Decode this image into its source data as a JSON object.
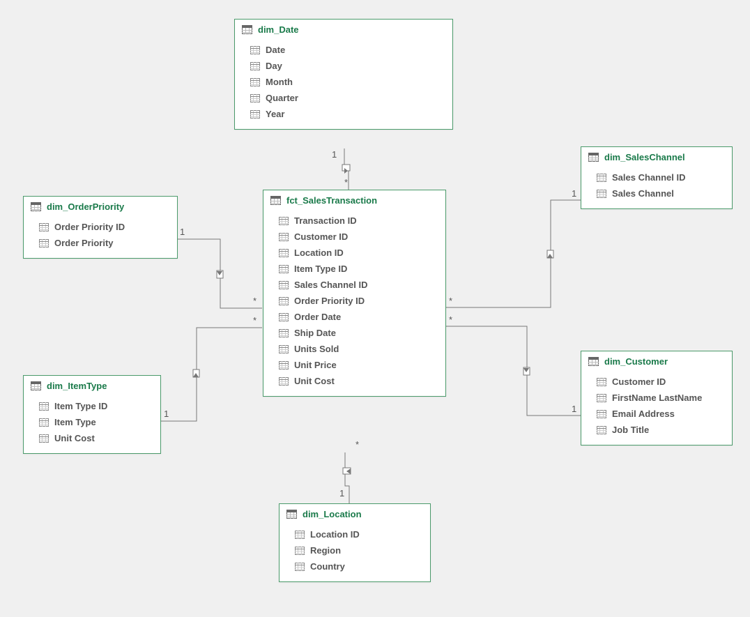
{
  "tables": {
    "date": {
      "title": "dim_Date",
      "fields": [
        "Date",
        "Day",
        "Month",
        "Quarter",
        "Year"
      ]
    },
    "salesChan": {
      "title": "dim_SalesChannel",
      "fields": [
        "Sales Channel ID",
        "Sales Channel"
      ]
    },
    "orderPrio": {
      "title": "dim_OrderPriority",
      "fields": [
        "Order Priority ID",
        "Order Priority"
      ]
    },
    "fact": {
      "title": "fct_SalesTransaction",
      "fields": [
        "Transaction ID",
        "Customer ID",
        "Location ID",
        "Item Type ID",
        "Sales Channel ID",
        "Order Priority ID",
        "Order Date",
        "Ship Date",
        "Units Sold",
        "Unit Price",
        "Unit Cost"
      ]
    },
    "itemType": {
      "title": "dim_ItemType",
      "fields": [
        "Item Type ID",
        "Item Type",
        "Unit Cost"
      ]
    },
    "customer": {
      "title": "dim_Customer",
      "fields": [
        "Customer ID",
        "FirstName LastName",
        "Email Address",
        "Job Title"
      ]
    },
    "location": {
      "title": "dim_Location",
      "fields": [
        "Location ID",
        "Region",
        "Country"
      ]
    }
  },
  "cardinality": {
    "one": "1",
    "many": "*"
  }
}
